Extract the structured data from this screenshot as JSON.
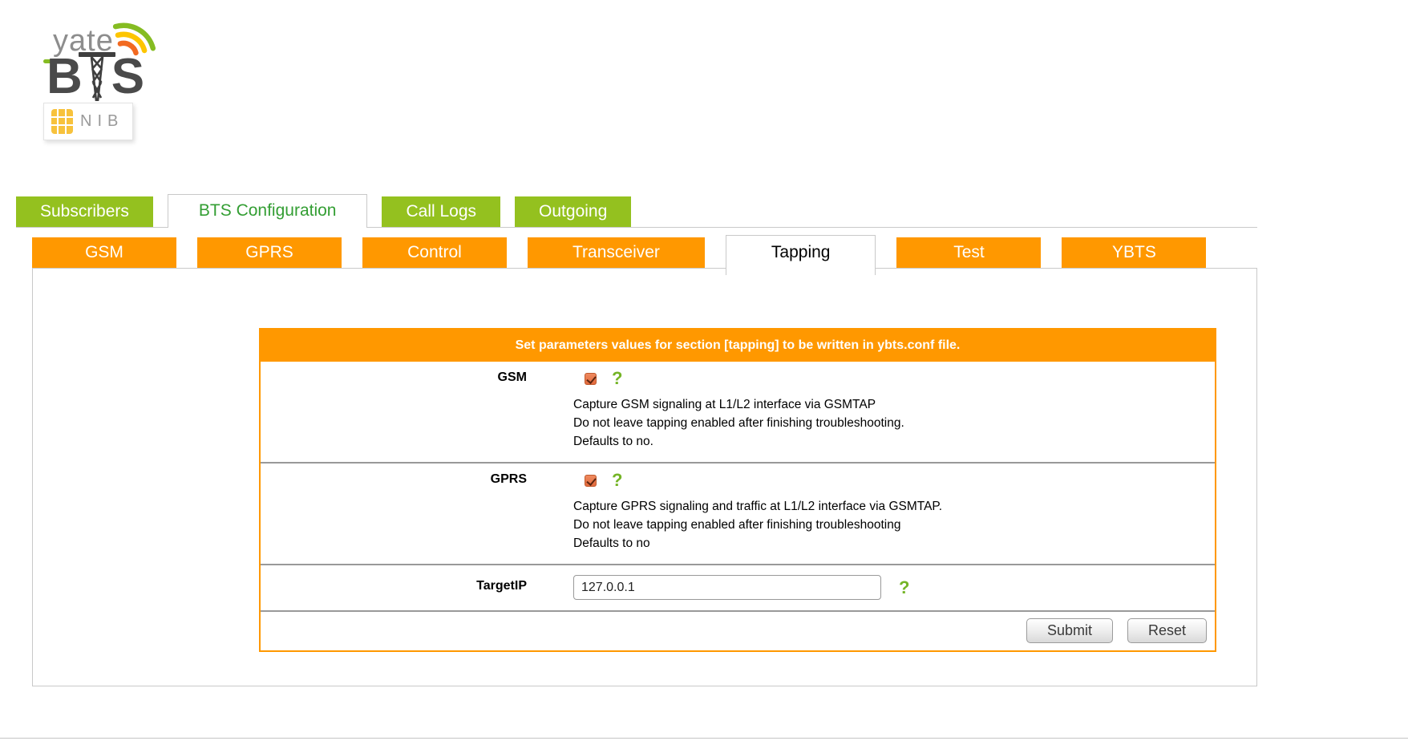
{
  "logo": {
    "brand": "yate",
    "bts_left": "B",
    "bts_right": "S",
    "badge": "NIB"
  },
  "main_tabs": {
    "items": [
      {
        "label": "Subscribers",
        "active": false
      },
      {
        "label": "BTS Configuration",
        "active": true
      },
      {
        "label": "Call Logs",
        "active": false
      },
      {
        "label": "Outgoing",
        "active": false
      }
    ]
  },
  "sub_tabs": {
    "items": [
      {
        "label": "GSM",
        "active": false
      },
      {
        "label": "GPRS",
        "active": false
      },
      {
        "label": "Control",
        "active": false
      },
      {
        "label": "Transceiver",
        "active": false
      },
      {
        "label": "Tapping",
        "active": true
      },
      {
        "label": "Test",
        "active": false
      },
      {
        "label": "YBTS",
        "active": false
      }
    ]
  },
  "form": {
    "header": "Set parameters values for section [tapping] to be written in ybts.conf file.",
    "rows": [
      {
        "label": "GSM",
        "type": "checkbox",
        "checked": "checked",
        "help_icon": "?",
        "description": [
          "Capture GSM signaling at L1/L2 interface via GSMTAP",
          "Do not leave tapping enabled after finishing troubleshooting.",
          "Defaults to no."
        ]
      },
      {
        "label": "GPRS",
        "type": "checkbox",
        "checked": "checked",
        "help_icon": "?",
        "description": [
          "Capture GPRS signaling and traffic at L1/L2 interface via GSMTAP.",
          "Do not leave tapping enabled after finishing troubleshooting",
          "Defaults to no"
        ]
      },
      {
        "label": "TargetIP",
        "type": "text",
        "value": "127.0.0.1",
        "help_icon": "?"
      }
    ],
    "buttons": {
      "submit": "Submit",
      "reset": "Reset"
    }
  },
  "colors": {
    "tab_green": "#94c11f",
    "tab_orange": "#ff9800",
    "active_main_tab_text": "#339e33",
    "help_green": "#74b426",
    "table_border": "#ff9800",
    "row_divider": "#999999"
  },
  "icons": {
    "help": "question-mark-help-icon",
    "checkbox": "checked-checkbox",
    "logo_waves": "radio-waves-icon",
    "logo_tower": "radio-tower-icon",
    "sim": "sim-chip-icon"
  }
}
